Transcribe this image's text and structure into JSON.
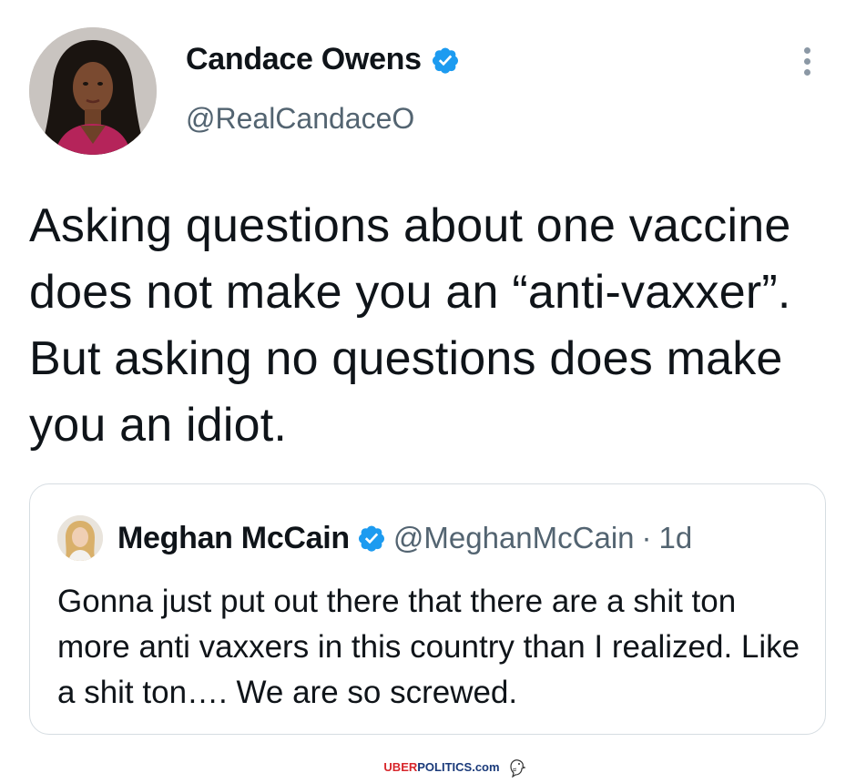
{
  "tweet": {
    "author": {
      "display_name": "Candace Owens",
      "handle": "@RealCandaceO",
      "verified": true,
      "avatar_icon": "profile-photo"
    },
    "more_icon": "more-vertical-icon",
    "text": "Asking questions about one vaccine does not make you an “anti-vaxxer”. But asking no questions does make you an idiot."
  },
  "quoted_tweet": {
    "author": {
      "display_name": "Meghan McCain",
      "handle": "@MeghanMcCain",
      "verified": true,
      "avatar_icon": "profile-photo"
    },
    "separator": "·",
    "time": "1d",
    "text": "Gonna just put out there that there are a shit ton more anti vaxxers in this country than I realized. Like a shit ton…. We are so screwed."
  },
  "watermark": {
    "part1": "UBER",
    "part2": "POLITICS",
    "part3": ".com",
    "icon": "eagle-icon"
  },
  "colors": {
    "verified_blue": "#1d9bf0",
    "text": "#0f1419",
    "secondary_text": "#536471",
    "border": "#d6dde2"
  }
}
